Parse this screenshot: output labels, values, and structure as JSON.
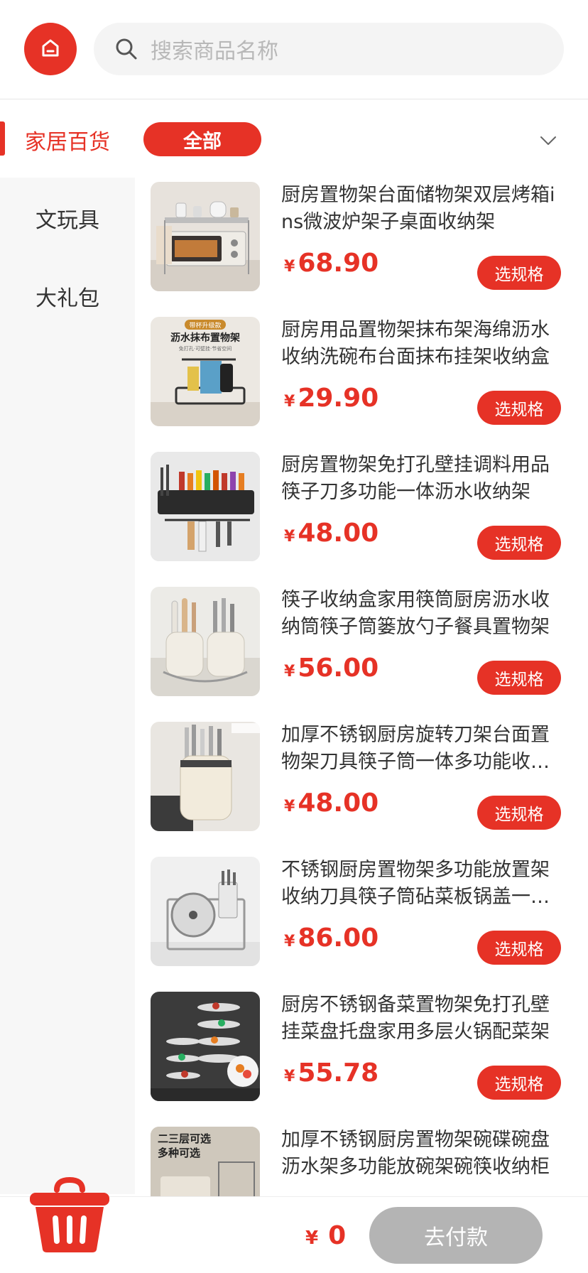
{
  "header": {
    "search_placeholder": "搜索商品名称"
  },
  "sidebar": {
    "items": [
      {
        "label": "家居百货",
        "active": true
      },
      {
        "label": "文玩具",
        "active": false
      },
      {
        "label": "大礼包",
        "active": false
      }
    ]
  },
  "filter": {
    "selected_label": "全部"
  },
  "products": [
    {
      "title": "厨房置物架台面储物架双层烤箱ins微波炉架子桌面收纳架",
      "currency": "¥",
      "price": "68.90",
      "spec_label": "选规格"
    },
    {
      "title": "厨房用品置物架抹布架海绵沥水收纳洗碗布台面抹布挂架收纳盒",
      "currency": "¥",
      "price": "29.90",
      "spec_label": "选规格"
    },
    {
      "title": "厨房置物架免打孔壁挂调料用品筷子刀多功能一体沥水收纳架",
      "currency": "¥",
      "price": "48.00",
      "spec_label": "选规格"
    },
    {
      "title": "筷子收纳盒家用筷筒厨房沥水收纳筒筷子筒篓放勺子餐具置物架",
      "currency": "¥",
      "price": "56.00",
      "spec_label": "选规格"
    },
    {
      "title": "加厚不锈钢厨房旋转刀架台面置物架刀具筷子筒一体多功能收纳架",
      "currency": "¥",
      "price": "48.00",
      "spec_label": "选规格"
    },
    {
      "title": "不锈钢厨房置物架多功能放置架收纳刀具筷子筒砧菜板锅盖一体架",
      "currency": "¥",
      "price": "86.00",
      "spec_label": "选规格"
    },
    {
      "title": "厨房不锈钢备菜置物架免打孔壁挂菜盘托盘家用多层火锅配菜架",
      "currency": "¥",
      "price": "55.78",
      "spec_label": "选规格"
    },
    {
      "title": "加厚不锈钢厨房置物架碗碟碗盘沥水架多功能放碗架碗筷收纳柜",
      "currency": "¥",
      "price": "",
      "spec_label": ""
    }
  ],
  "thumb_text": {
    "p2_badge": "带杯升级款",
    "p2_title": "沥水抹布置物架",
    "p2_sub": "免打孔·可壁挂·节省空间",
    "p8_line1": "二三层可选",
    "p8_line2": "多种可选"
  },
  "footer": {
    "currency": "¥",
    "total": "0",
    "pay_label": "去付款"
  },
  "colors": {
    "accent": "#e63226",
    "disabled": "#b4b4b4",
    "sidebar_bg": "#f7f7f7"
  },
  "icons": [
    "home-icon",
    "search-icon",
    "chevron-down-icon",
    "basket-icon"
  ]
}
